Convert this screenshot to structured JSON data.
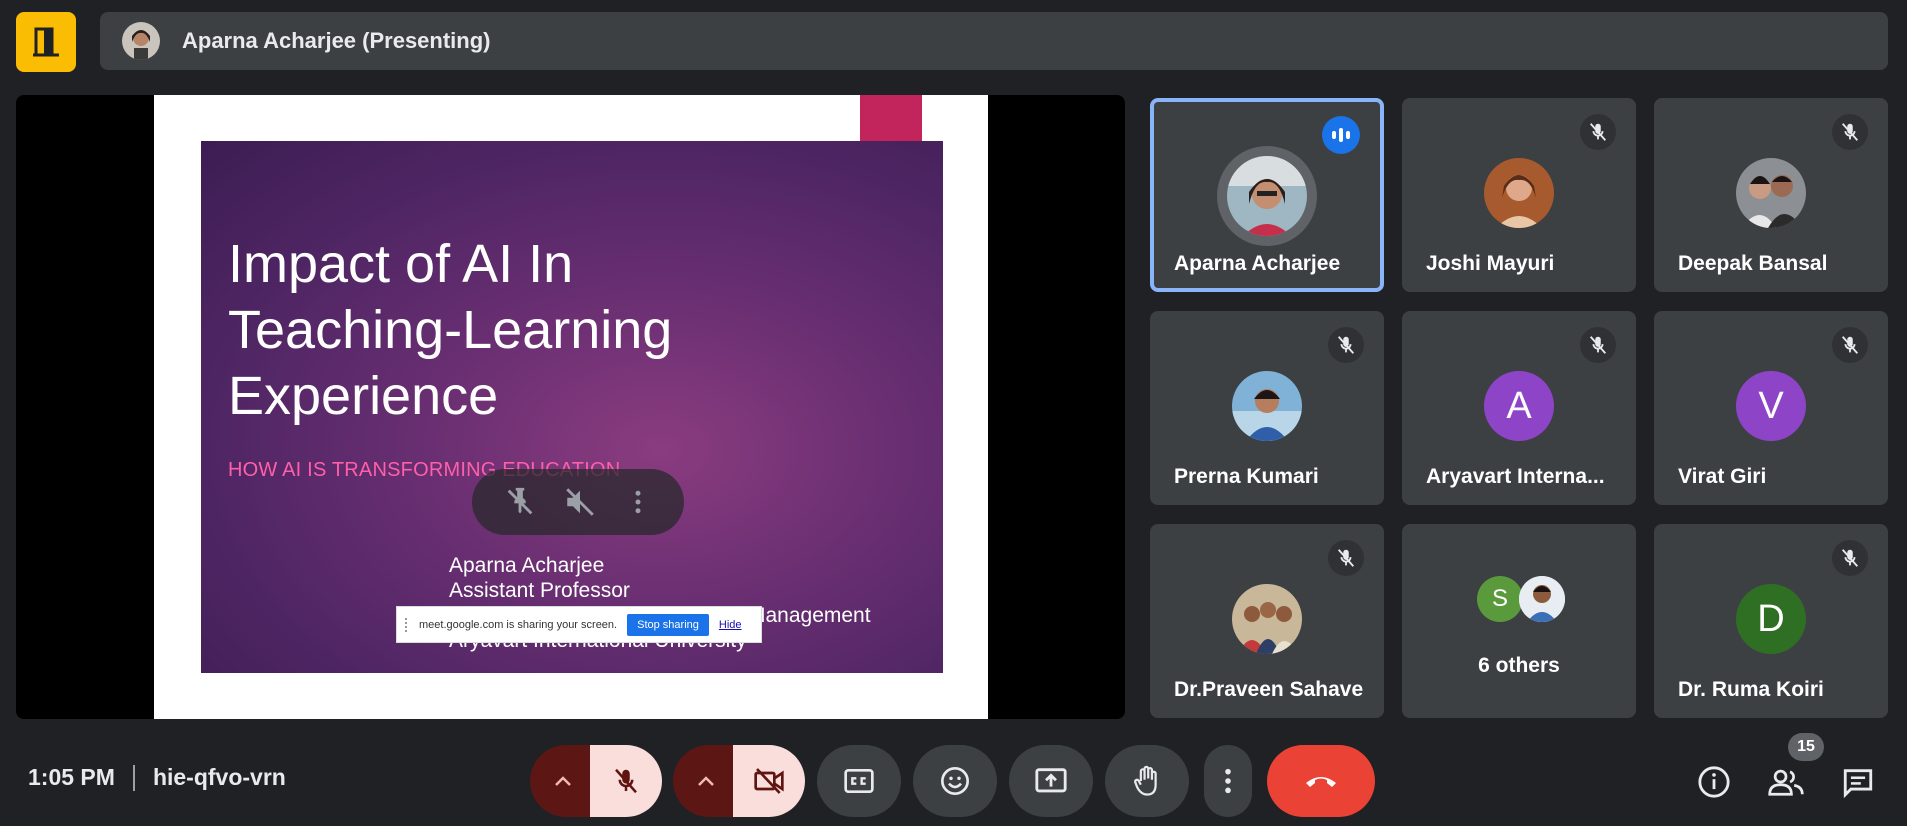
{
  "header": {
    "presenter_label": "Aparna Acharjee (Presenting)"
  },
  "slide": {
    "title_lines": [
      "Impact of AI In",
      "Teaching-Learning",
      "Experience"
    ],
    "subtitle": "HOW AI IS TRANSFORMING EDUCATION",
    "author_lines": [
      "Aparna Acharjee",
      "Assistant Professor",
      "Management",
      "Aryavart International University"
    ]
  },
  "share_banner": {
    "message": "meet.google.com is sharing your screen.",
    "stop_label": "Stop sharing",
    "hide_label": "Hide"
  },
  "participants": [
    {
      "name": "Aparna Acharjee",
      "state": "speaking",
      "avatar": "photo"
    },
    {
      "name": "Joshi Mayuri",
      "state": "muted",
      "avatar": "photo"
    },
    {
      "name": "Deepak Bansal",
      "state": "muted",
      "avatar": "photo"
    },
    {
      "name": "Prerna Kumari",
      "state": "muted",
      "avatar": "photo"
    },
    {
      "name": "Aryavart Interna...",
      "state": "muted",
      "avatar_letter": "A",
      "avatar_color": "#8e44c7"
    },
    {
      "name": "Virat Giri",
      "state": "muted",
      "avatar_letter": "V",
      "avatar_color": "#8e44c7"
    },
    {
      "name": "Dr.Praveen Sahave",
      "state": "muted",
      "avatar": "photo"
    },
    {
      "name": "6 others",
      "avatar_letter": "S",
      "avatar_color": "#5b9a3c"
    },
    {
      "name": "Dr. Ruma Koiri",
      "state": "muted",
      "avatar_letter": "D",
      "avatar_color": "#2f6f23"
    }
  ],
  "footer": {
    "time": "1:05 PM",
    "meeting_code": "hie-qfvo-vrn",
    "participant_count": "15"
  },
  "colors": {
    "background": "#202124",
    "tile": "#3c4043",
    "active_border": "#8ab4f8",
    "end_call": "#ea4335",
    "logo": "#fbbc04"
  }
}
